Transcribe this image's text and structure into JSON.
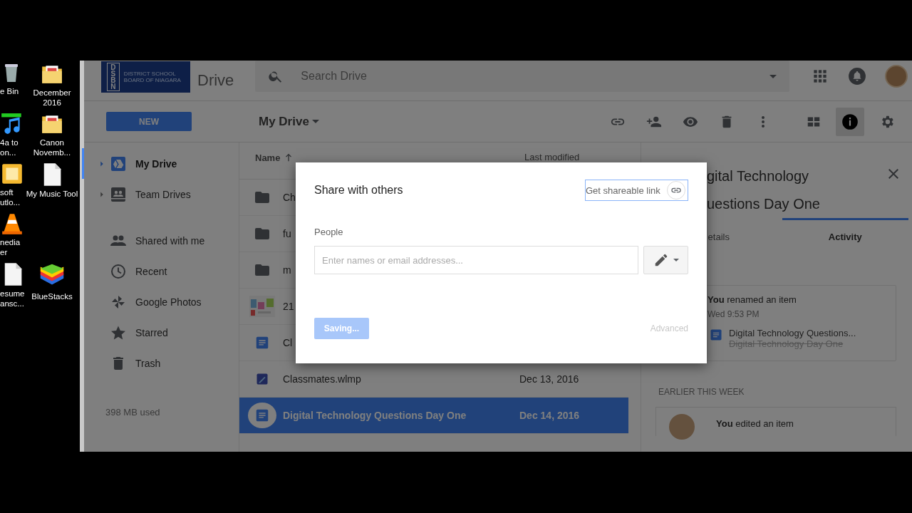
{
  "desktop": {
    "rows": [
      {
        "icons": [
          {
            "label": "e Bin",
            "kind": "bin"
          },
          {
            "label": "December 2016",
            "kind": "folder"
          }
        ]
      },
      {
        "icons": [
          {
            "label": "4a to on...",
            "kind": "music"
          },
          {
            "label": "Canon Novemb...",
            "kind": "folder"
          }
        ]
      },
      {
        "icons": [
          {
            "label": "soft utlo...",
            "kind": "office"
          },
          {
            "label": "My Music Tool",
            "kind": "page"
          }
        ]
      },
      {
        "icons": [
          {
            "label": "nedia er",
            "kind": "cone"
          }
        ]
      },
      {
        "icons": [
          {
            "label": "esume ansc...",
            "kind": "page"
          },
          {
            "label": "BlueStacks",
            "kind": "stack"
          }
        ]
      }
    ]
  },
  "header": {
    "logo": {
      "mark": "DSBN",
      "text": "DISTRICT SCHOOL BOARD OF NIAGARA"
    },
    "app_name": "Drive",
    "search": {
      "placeholder": "Search Drive"
    }
  },
  "new_button": "NEW",
  "breadcrumb": "My Drive",
  "toolbar": {
    "info_selected": true
  },
  "sidebar": {
    "drives": [
      {
        "label": "My Drive",
        "kind": "drive",
        "selected": true
      },
      {
        "label": "Team Drives",
        "kind": "team",
        "selected": false
      }
    ],
    "views": [
      {
        "label": "Shared with me",
        "kind": "people",
        "selected": false
      },
      {
        "label": "Recent",
        "kind": "clock",
        "selected": false
      },
      {
        "label": "Google Photos",
        "kind": "photos",
        "selected": false
      },
      {
        "label": "Starred",
        "kind": "star",
        "selected": false
      },
      {
        "label": "Trash",
        "kind": "trash",
        "selected": false
      }
    ],
    "storage": "398 MB used"
  },
  "file_list": {
    "columns": [
      "Name",
      "Last modified"
    ],
    "rows": [
      {
        "name": "Ch",
        "kind": "folder",
        "selected": false
      },
      {
        "name": "fu",
        "kind": "folder",
        "selected": false
      },
      {
        "name": "m",
        "kind": "folder",
        "selected": false
      },
      {
        "name": "21",
        "selected": false
      },
      {
        "name": "Cl",
        "kind": "doc",
        "selected": false
      },
      {
        "name": "Classmates.wlmp",
        "modified": "Dec 13, 2016",
        "kind": "video",
        "selected": false
      },
      {
        "name": "Digital Technology Questions Day One",
        "modified": "Dec 14, 2016",
        "kind": "doc",
        "selected": true
      }
    ]
  },
  "details": {
    "title": [
      "gital Technology",
      "uestions Day One"
    ],
    "tabs": [
      {
        "label": "etails",
        "selected": false
      },
      {
        "label": "Activity",
        "selected": true
      }
    ],
    "activity": [
      {
        "text": "**You** renamed an item",
        "time": "Wed 9:53 PM",
        "item_name": "Digital Technology Questions...",
        "previous_name": "Digital Technology Day One"
      }
    ],
    "section": "EARLIER THIS WEEK",
    "next": "**You** edited an item"
  },
  "dialog": {
    "title": "Share with others",
    "link_button": "Get shareable link",
    "people_label": "People",
    "input": {
      "placeholder": "Enter names or email addresses..."
    },
    "save_button": {
      "label": "Saving...",
      "disabled": true
    },
    "advanced": {
      "label": "Advanced",
      "disabled": true
    }
  }
}
